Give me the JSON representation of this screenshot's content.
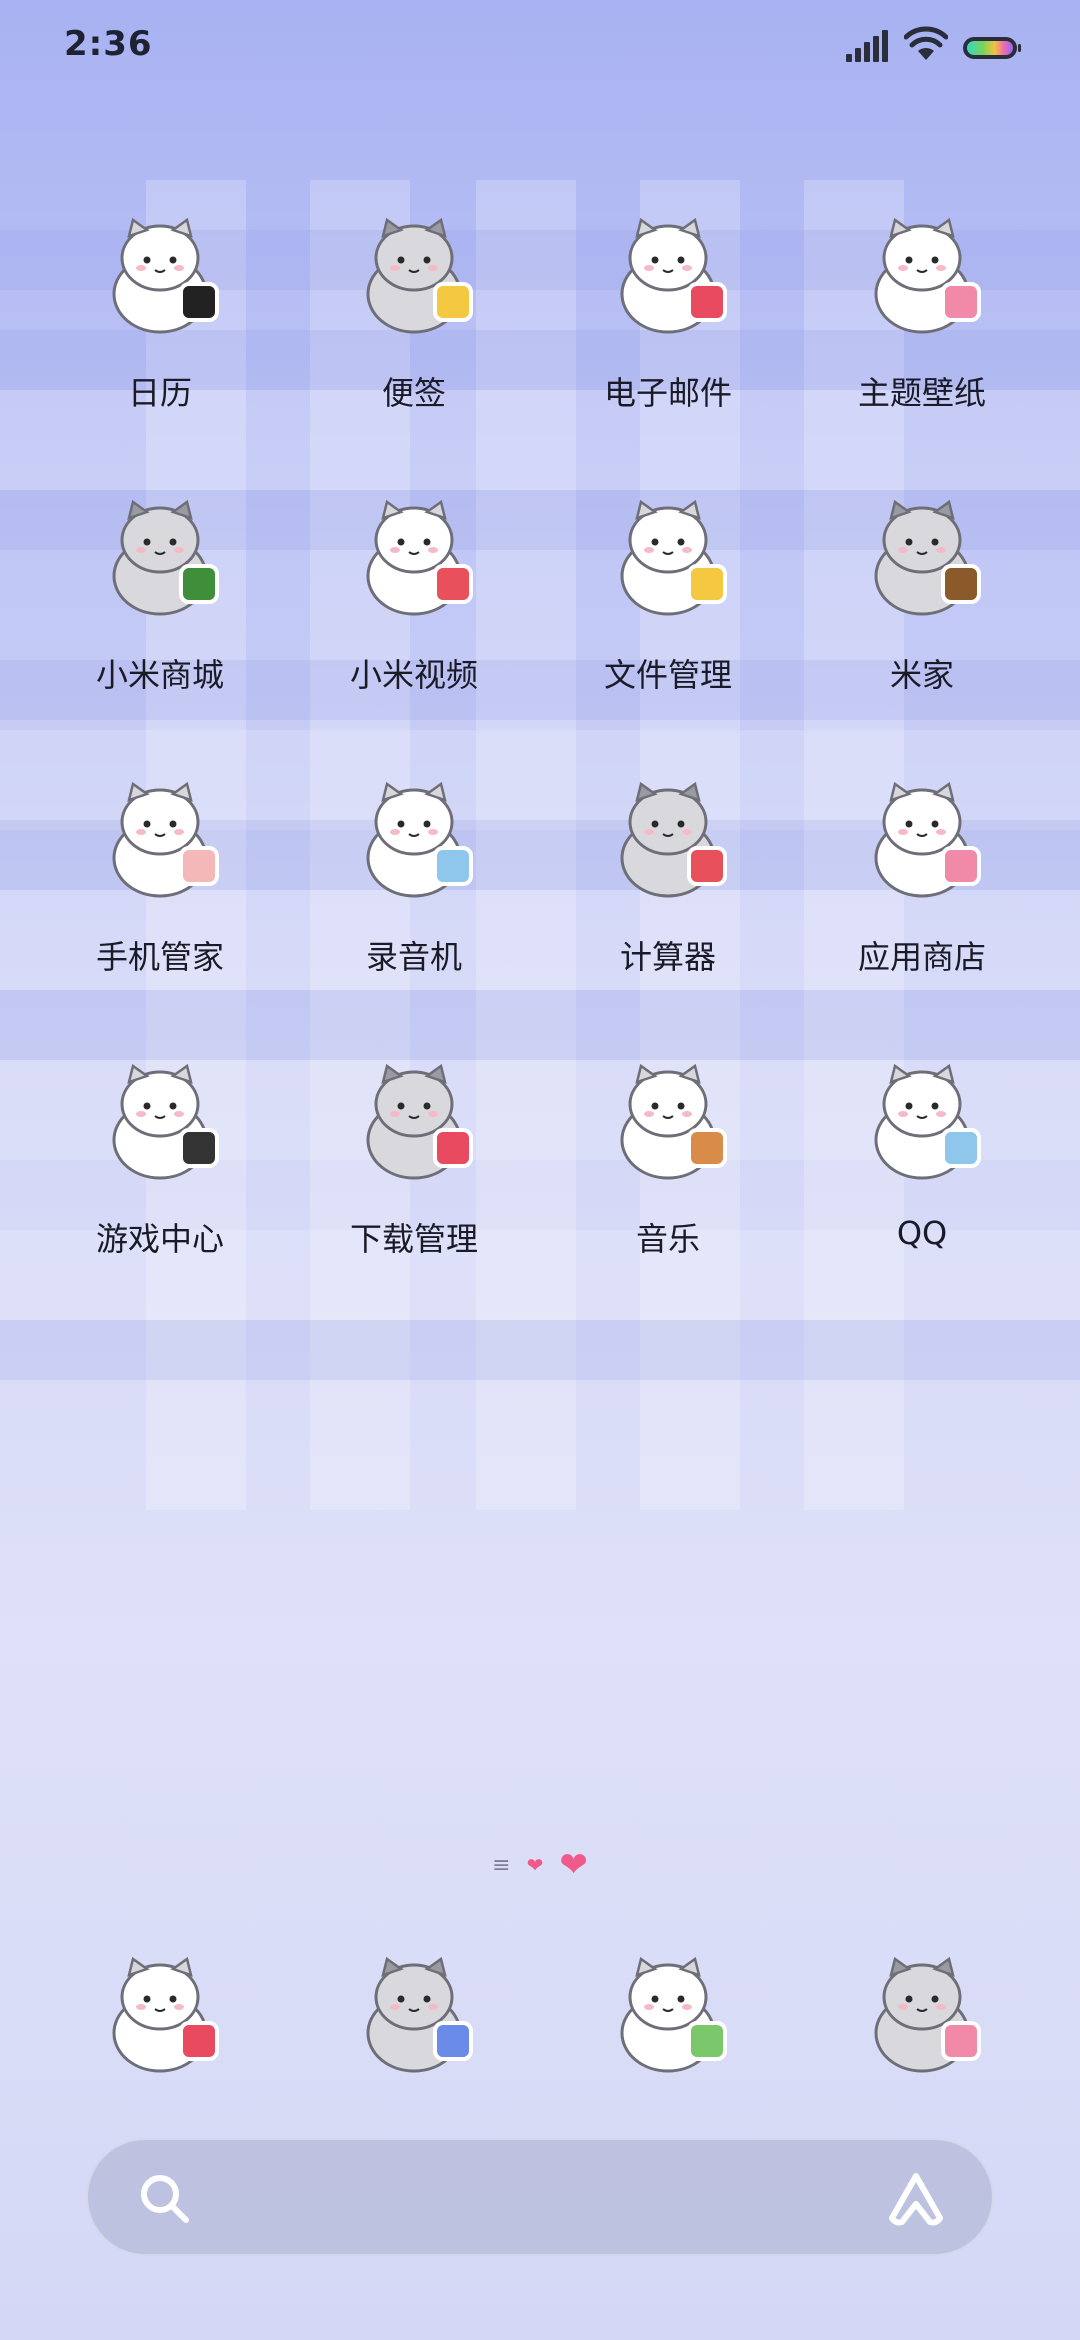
{
  "status_bar": {
    "time": "2:36",
    "icons": [
      "signal-icon",
      "wifi-icon",
      "battery-icon"
    ]
  },
  "apps": [
    {
      "label": "日历",
      "icon": "calendar-cat-icon",
      "accent": "#222222"
    },
    {
      "label": "便签",
      "icon": "notes-cat-icon",
      "accent": "#f5c842"
    },
    {
      "label": "电子邮件",
      "icon": "email-cat-icon",
      "accent": "#e84a5f"
    },
    {
      "label": "主题壁纸",
      "icon": "theme-cat-icon",
      "accent": "#f08aa8"
    },
    {
      "label": "小米商城",
      "icon": "mall-cat-icon",
      "accent": "#3f8f3a"
    },
    {
      "label": "小米视频",
      "icon": "video-cat-icon",
      "accent": "#e8505b"
    },
    {
      "label": "文件管理",
      "icon": "files-cat-icon",
      "accent": "#f5c842"
    },
    {
      "label": "米家",
      "icon": "mijia-cat-icon",
      "accent": "#8a5a2a"
    },
    {
      "label": "手机管家",
      "icon": "security-cat-icon",
      "accent": "#f4b8b8"
    },
    {
      "label": "录音机",
      "icon": "recorder-cat-icon",
      "accent": "#8fc7ec"
    },
    {
      "label": "计算器",
      "icon": "calculator-cat-icon",
      "accent": "#e8505b"
    },
    {
      "label": "应用商店",
      "icon": "appstore-cat-icon",
      "accent": "#f08aa8"
    },
    {
      "label": "游戏中心",
      "icon": "games-cat-icon",
      "accent": "#333333"
    },
    {
      "label": "下载管理",
      "icon": "download-cat-icon",
      "accent": "#e84a5f"
    },
    {
      "label": "音乐",
      "icon": "music-cat-icon",
      "accent": "#d98b4a"
    },
    {
      "label": "QQ",
      "icon": "qq-cat-icon",
      "accent": "#8fc7ec"
    }
  ],
  "page_indicator": {
    "dot": "≡",
    "small_heart": "❤",
    "big_heart": "❤"
  },
  "dock": [
    {
      "icon": "phone-cat-icon",
      "accent": "#e84a5f"
    },
    {
      "icon": "browser-cat-icon",
      "accent": "#6a8be8"
    },
    {
      "icon": "messages-cat-icon",
      "accent": "#7bc86c"
    },
    {
      "icon": "camera-cat-icon",
      "accent": "#f08aa8"
    }
  ],
  "search": {
    "icons": [
      "search-icon",
      "assistant-icon"
    ]
  }
}
